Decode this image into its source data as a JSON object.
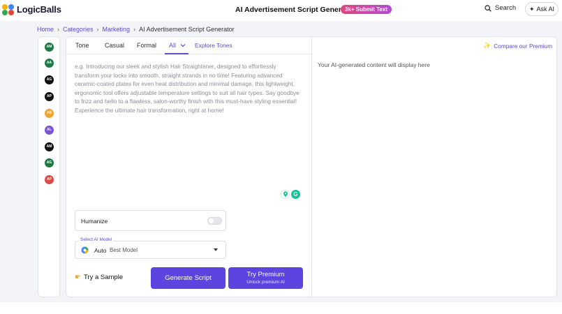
{
  "header": {
    "logo_text": "LogicBalls",
    "page_title": "AI Advertisement Script Generator",
    "badge": "3k+ Submit Text",
    "search_label": "Search",
    "ask_label": "Ask AI"
  },
  "breadcrumb": [
    "Home",
    "Categories",
    "Marketing",
    "AI Advertisement Script Generator"
  ],
  "rail_avatars": [
    {
      "initials": "AM",
      "color": "#1e7a45"
    },
    {
      "initials": "AA",
      "color": "#1e7a45"
    },
    {
      "initials": "AG",
      "color": "#111111"
    },
    {
      "initials": "AP",
      "color": "#111111"
    },
    {
      "initials": "AB",
      "color": "#f0a232"
    },
    {
      "initials": "AL",
      "color": "#7a55d6"
    },
    {
      "initials": "AM",
      "color": "#111111"
    },
    {
      "initials": "AG",
      "color": "#1e7a45"
    },
    {
      "initials": "AP",
      "color": "#e04848"
    }
  ],
  "tabs": [
    "Tone",
    "Casual",
    "Formal",
    "All"
  ],
  "explore_tones": "Explore Tones",
  "compare_premium": "Compare our Premium",
  "input": {
    "placeholder": "e.g. Introducing our sleek and stylish Hair Straightener, designed to effortlessly transform your locks into smooth, straight strands in no time! Featuring advanced ceramic-coated plates for even heat distribution and minimal damage, this lightweight, ergonomic tool offers adjustable temperature settings to suit all hair types. Say goodbye to frizz and hello to a flawless, salon-worthy finish with this must-have styling essential! Experience the ultimate hair transformation, right at home!"
  },
  "humanize": {
    "label": "Humanize",
    "enabled": false
  },
  "model": {
    "label": "Select AI Model",
    "name": "Auto",
    "sub": "Best Model"
  },
  "actions": {
    "sample": "Try a Sample",
    "generate": "Generate Script",
    "premium_title": "Try Premium",
    "premium_sub": "Unlock premium AI"
  },
  "output_message": "Your AI-generated content will display here",
  "colors": {
    "accent": "#5b44e0",
    "link": "#5b4ccc"
  }
}
